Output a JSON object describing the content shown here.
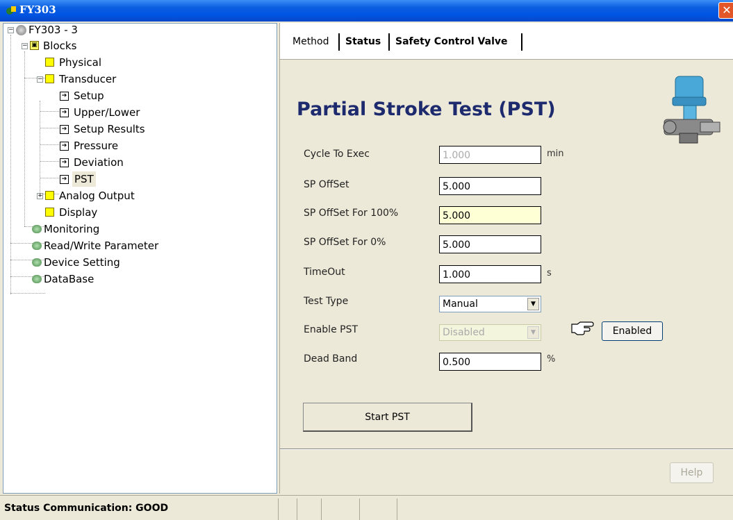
{
  "window": {
    "title": "FY303",
    "close": "✕"
  },
  "tree": {
    "root": "FY303 - 3",
    "blocks": "Blocks",
    "physical": "Physical",
    "transducer": "Transducer",
    "transducer_items": [
      "Setup",
      "Upper/Lower",
      "Setup Results",
      "Pressure",
      "Deviation",
      "PST"
    ],
    "analog_output": "Analog Output",
    "display": "Display",
    "monitoring": "Monitoring",
    "read_write": "Read/Write Parameter",
    "device_setting": "Device Setting",
    "database": "DataBase"
  },
  "tabs": [
    "Method",
    "Status",
    "Safety Control Valve"
  ],
  "form": {
    "heading": "Partial Stroke Test (PST)",
    "cycle_to_exec": {
      "label": "Cycle To Exec",
      "value": "1.000",
      "unit": "min"
    },
    "sp_offset": {
      "label": "SP OffSet",
      "value": "5.000"
    },
    "sp_offset_100": {
      "label": "SP OffSet For 100%",
      "value": "5.000"
    },
    "sp_offset_0": {
      "label": "SP OffSet For 0%",
      "value": "5.000"
    },
    "timeout": {
      "label": "TimeOut",
      "value": "1.000",
      "unit": "s"
    },
    "test_type": {
      "label": "Test Type",
      "value": "Manual"
    },
    "enable_pst": {
      "label": "Enable PST",
      "value": "Disabled",
      "button": "Enabled"
    },
    "dead_band": {
      "label": "Dead Band",
      "value": "0.500",
      "unit": "%"
    },
    "start_button": "Start PST",
    "help_button": "Help"
  },
  "status_bar": {
    "text": "Status Communication: GOOD"
  },
  "colors": {
    "title_bar": "#0054e3",
    "heading": "#1d2a6e",
    "highlight_field": "#ffffd6"
  }
}
